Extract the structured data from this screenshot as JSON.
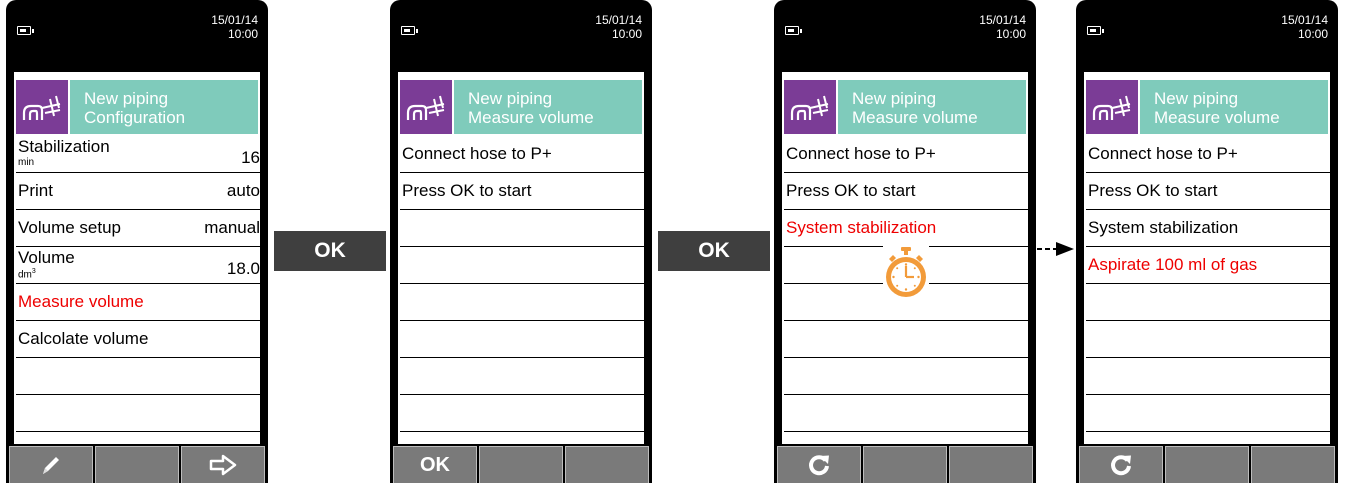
{
  "status": {
    "date": "15/01/14",
    "time": "10:00"
  },
  "screen1": {
    "header": {
      "line1": "New piping",
      "line2": "Configuration"
    },
    "rows": [
      {
        "label": "Stabilization",
        "unit": "min",
        "value": "16"
      },
      {
        "label": "Print",
        "value": "auto"
      },
      {
        "label": "Volume setup",
        "value": "manual"
      },
      {
        "label": "Volume",
        "unit": "dm",
        "unit_sup": "3",
        "value": "18.0"
      },
      {
        "label": "Measure volume"
      },
      {
        "label": "Calcolate volume"
      }
    ],
    "buttons": {
      "left_icon": "pencil-icon",
      "right_icon": "arrow-right-icon"
    }
  },
  "screen2": {
    "header": {
      "line1": "New piping",
      "line2": "Measure volume"
    },
    "rows": [
      "Connect hose to P+",
      "Press OK to start"
    ],
    "buttons": {
      "left_label": "OK"
    }
  },
  "screen3": {
    "header": {
      "line1": "New piping",
      "line2": "Measure volume"
    },
    "rows": [
      "Connect hose to P+",
      "Press OK to start",
      "System stabilization"
    ],
    "buttons": {
      "left_icon": "refresh-icon"
    },
    "status_icon": "stopwatch-icon"
  },
  "screen4": {
    "header": {
      "line1": "New piping",
      "line2": "Measure volume"
    },
    "rows": [
      "Connect hose to P+",
      "Press OK to start",
      "System stabilization",
      "Aspirate 100 ml of gas"
    ],
    "buttons": {
      "left_icon": "refresh-icon"
    }
  },
  "transitions": [
    "OK",
    "OK"
  ],
  "colors": {
    "highlight": "#ee0000",
    "header_teal": "#7fcbbb",
    "header_icon_purple": "#7b3c96",
    "button_gray": "#7a7a7a"
  }
}
